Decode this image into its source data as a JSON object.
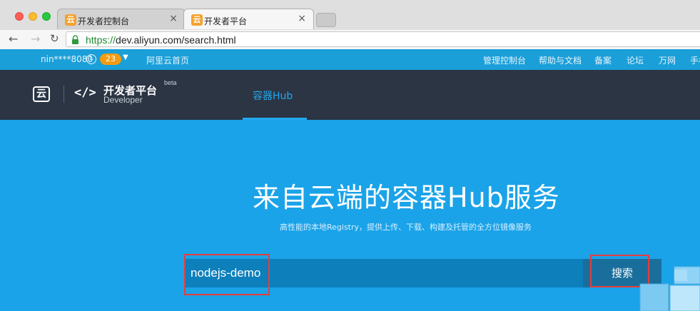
{
  "browser": {
    "tabs": [
      {
        "title": "开发者控制台",
        "favicon": "aliyun-icon",
        "active": false
      },
      {
        "title": "开发者平台",
        "favicon": "aliyun-icon",
        "active": true
      }
    ],
    "close_glyph": "×",
    "url_protocol": "https://",
    "url_rest": "dev.aliyun.com/search.html",
    "favicon_glyph": "云"
  },
  "topbar": {
    "username": "nin****8080",
    "message_count": "23",
    "home_link": "阿里云首页",
    "links": [
      "管理控制台",
      "帮助与文档",
      "备案",
      "论坛",
      "万网",
      "手机"
    ]
  },
  "header": {
    "logo_glyph": "云",
    "code_glyph": "</>",
    "brand_title": "开发者平台",
    "brand_subtitle": "Developer",
    "brand_badge": "beta",
    "nav_item": "容器Hub"
  },
  "hero": {
    "title": "来自云端的容器Hub服务",
    "subtitle": "高性能的本地Registry，提供上传、下载、构建及托管的全方位镜像服务",
    "search_value": "nodejs-demo",
    "search_button": "搜索"
  },
  "colors": {
    "hero_bg": "#1aa3e8",
    "header_bg": "#2b3544",
    "topbar_bg": "#1a9fd9",
    "badge": "#f39c12",
    "accent": "#22a8ef",
    "highlight": "#e53e3e"
  }
}
